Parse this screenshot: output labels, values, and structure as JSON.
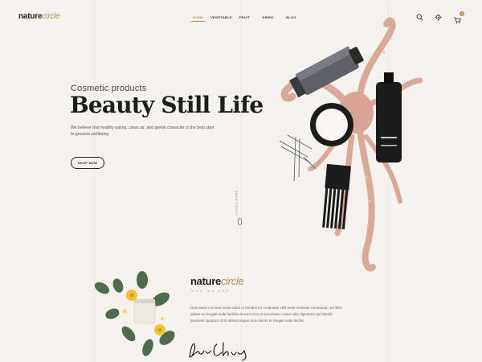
{
  "brand": {
    "logo_main": "nature",
    "logo_accent": "circle"
  },
  "nav": {
    "items": [
      {
        "label": "HOME",
        "active": true
      },
      {
        "label": "VEGETABLE",
        "active": false
      },
      {
        "label": "FRUIT",
        "active": false
      },
      {
        "label": "DRIED",
        "active": false
      },
      {
        "label": "BLOG",
        "active": false
      }
    ]
  },
  "header": {
    "cart_count": "0",
    "icons": [
      "search-icon",
      "gear-icon",
      "cart-icon"
    ]
  },
  "hero": {
    "kicker": "Cosmetic products",
    "title": "Beauty Still Life",
    "description": "We believe that healthy eating, clean air, and gentle character is the best start to genuine wellbeing",
    "button_label": "SHOP NOW",
    "scroll_label": "SCROLL DOWN"
  },
  "about": {
    "logo_main": "nature",
    "logo_accent": "circle",
    "tagline": "WHO WE ARE",
    "text": "Duis autem vel eum iriure dolor in hendrerit in vulputate velit esse molestie consequat, vel illum dolore eu feugiat nulla facilisis at vero eros et accumsan t iusto odio dignissim qui blandit praesent luptatum zzril delenit augue duis dolore te feugait nulla facilisi."
  },
  "colors": {
    "accent": "#b58f4a",
    "background": "#f3f2ee",
    "text": "#1d1d1d"
  }
}
